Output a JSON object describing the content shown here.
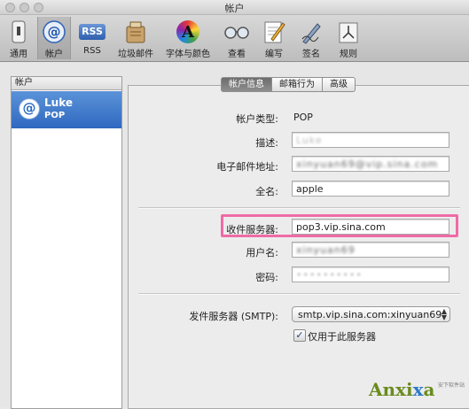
{
  "window": {
    "title": "帐户"
  },
  "toolbar": {
    "items": [
      {
        "label": "通用",
        "icon": "general-switch-icon"
      },
      {
        "label": "帐户",
        "icon": "at-sign-icon",
        "selected": true
      },
      {
        "label": "RSS",
        "icon": "rss-icon",
        "icon_text": "RSS"
      },
      {
        "label": "垃圾邮件",
        "icon": "junk-mail-icon"
      },
      {
        "label": "字体与颜色",
        "icon": "fonts-colors-icon",
        "icon_text": "A"
      },
      {
        "label": "查看",
        "icon": "glasses-icon"
      },
      {
        "label": "编写",
        "icon": "compose-pencil-icon"
      },
      {
        "label": "签名",
        "icon": "signature-pen-icon"
      },
      {
        "label": "规则",
        "icon": "rules-icon"
      }
    ]
  },
  "sidebar": {
    "header": "帐户",
    "accounts": [
      {
        "name": "Luke",
        "type": "POP",
        "icon": "at-sign-icon",
        "selected": true
      }
    ]
  },
  "tabs": [
    {
      "label": "帐户信息",
      "active": true
    },
    {
      "label": "邮箱行为",
      "active": false
    },
    {
      "label": "高级",
      "active": false
    }
  ],
  "form": {
    "account_type_label": "帐户类型:",
    "account_type_value": "POP",
    "description_label": "描述:",
    "description_value": "Luke",
    "email_label": "电子邮件地址:",
    "email_value": "xinyuan69@vip.sina.com",
    "fullname_label": "全名:",
    "fullname_value": "apple",
    "incoming_label": "收件服务器:",
    "incoming_value": "pop3.vip.sina.com",
    "username_label": "用户名:",
    "username_value": "xinyuan69",
    "password_label": "密码:",
    "password_value": "••••••••••",
    "smtp_label": "发件服务器 (SMTP):",
    "smtp_value": "smtp.vip.sina.com:xinyuan69",
    "only_this_server_label": "仅用于此服务器",
    "only_this_server_checked": true
  },
  "watermark": {
    "brand_a": "Anxi",
    "brand_x": "x",
    "brand_b": "a",
    "sub": "安下软件站"
  },
  "colors": {
    "highlight": "#f06aa6",
    "selection": "#3a74c8"
  }
}
